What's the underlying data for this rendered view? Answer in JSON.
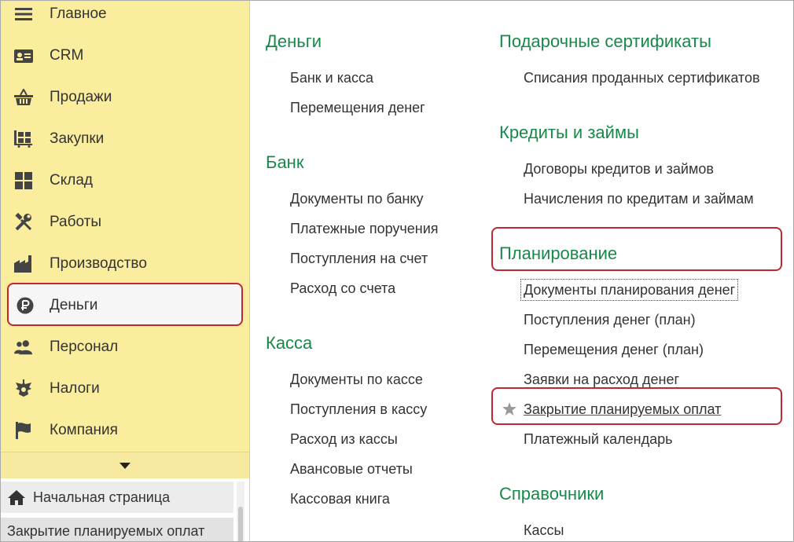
{
  "sidebar": {
    "items": [
      {
        "label": "Главное",
        "icon": "menu-lines-icon"
      },
      {
        "label": "CRM",
        "icon": "contact-card-icon"
      },
      {
        "label": "Продажи",
        "icon": "basket-icon"
      },
      {
        "label": "Закупки",
        "icon": "cart-icon"
      },
      {
        "label": "Склад",
        "icon": "warehouse-grid-icon"
      },
      {
        "label": "Работы",
        "icon": "tools-icon"
      },
      {
        "label": "Производство",
        "icon": "factory-icon"
      },
      {
        "label": "Деньги",
        "icon": "ruble-coin-icon"
      },
      {
        "label": "Персонал",
        "icon": "people-icon"
      },
      {
        "label": "Налоги",
        "icon": "eagle-emblem-icon"
      },
      {
        "label": "Компания",
        "icon": "flag-icon"
      }
    ],
    "selected": "Деньги"
  },
  "windows": {
    "home_label": "Начальная страница",
    "active_label": "Закрытие планируемых оплат"
  },
  "content": {
    "left_column": [
      {
        "title": "Деньги",
        "links": [
          "Банк и касса",
          "Перемещения денег"
        ]
      },
      {
        "title": "Банк",
        "links": [
          "Документы по банку",
          "Платежные поручения",
          "Поступления на счет",
          "Расход со счета"
        ]
      },
      {
        "title": "Касса",
        "links": [
          "Документы по кассе",
          "Поступления в кассу",
          "Расход из кассы",
          "Авансовые отчеты",
          "Кассовая книга"
        ]
      }
    ],
    "right_column": [
      {
        "title": "Подарочные сертификаты",
        "links": [
          "Списания проданных сертификатов"
        ]
      },
      {
        "title": "Кредиты и займы",
        "links": [
          "Договоры кредитов и займов",
          "Начисления по кредитам и займам"
        ]
      },
      {
        "title": "Планирование",
        "links": [
          "Документы планирования денег",
          "Поступления денег (план)",
          "Перемещения денег (план)",
          "Заявки на расход денег",
          "Закрытие планируемых оплат",
          "Платежный календарь"
        ]
      },
      {
        "title": "Справочники",
        "links": [
          "Кассы"
        ]
      }
    ]
  },
  "colors": {
    "sidebar_bg": "#fbed9e",
    "section_title": "#17894a",
    "highlight_border": "#c0282f",
    "star": "#9a9a9a"
  }
}
